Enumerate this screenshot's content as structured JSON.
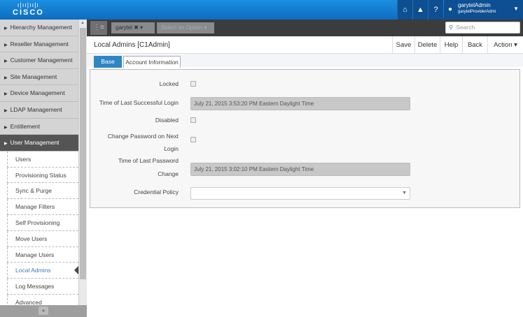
{
  "brand": {
    "logo_text": "CISCO"
  },
  "topbar": {
    "icons": [
      "home-icon",
      "alert-icon",
      "help-icon"
    ],
    "help_glyph": "?",
    "user": {
      "name": "garytelAdmin",
      "role": "garytelProviderAdmi"
    }
  },
  "sidebar": {
    "items": [
      {
        "label": "Hierarchy Management"
      },
      {
        "label": "Reseller Management"
      },
      {
        "label": "Customer Management"
      },
      {
        "label": "Site Management"
      },
      {
        "label": "Device Management"
      },
      {
        "label": "LDAP Management"
      },
      {
        "label": "Entitlement"
      },
      {
        "label": "User Management",
        "active": true
      }
    ],
    "subitems": [
      {
        "label": "Users"
      },
      {
        "label": "Provisioning Status"
      },
      {
        "label": "Sync & Purge"
      },
      {
        "label": "Manage Filters"
      },
      {
        "label": "Self Provisioning"
      },
      {
        "label": "Move Users"
      },
      {
        "label": "Manage Users"
      },
      {
        "label": "Local Admins",
        "current": true
      },
      {
        "label": "Log Messages"
      },
      {
        "label": "Advanced"
      }
    ],
    "collapse_glyph": "«"
  },
  "toolbar": {
    "hierarchy_chip": "garytel",
    "hierarchy_clear": "✖ ▾",
    "select_placeholder": "Select an Option ▾",
    "search_placeholder": "Search"
  },
  "header": {
    "title": "Local Admins [C1Admin]",
    "buttons": [
      "Save",
      "Delete",
      "Help",
      "Back",
      "Action"
    ]
  },
  "tabs": [
    {
      "label": "Base"
    },
    {
      "label": "Account Information"
    }
  ],
  "form": {
    "locked_label": "Locked",
    "locked": false,
    "last_login_label": "Time of Last Successful Login",
    "last_login": "July 21, 2015 3:53:20 PM Eastern Daylight Time",
    "disabled_label": "Disabled",
    "disabled": false,
    "change_pw_label": "Change Password on Next Login",
    "change_pw": false,
    "last_pw_label": "Time of Last Password Change",
    "last_pw": "July 21, 2015 3:02:10 PM Eastern Daylight Time",
    "credential_policy_label": "Credential Policy",
    "credential_policy": ""
  }
}
